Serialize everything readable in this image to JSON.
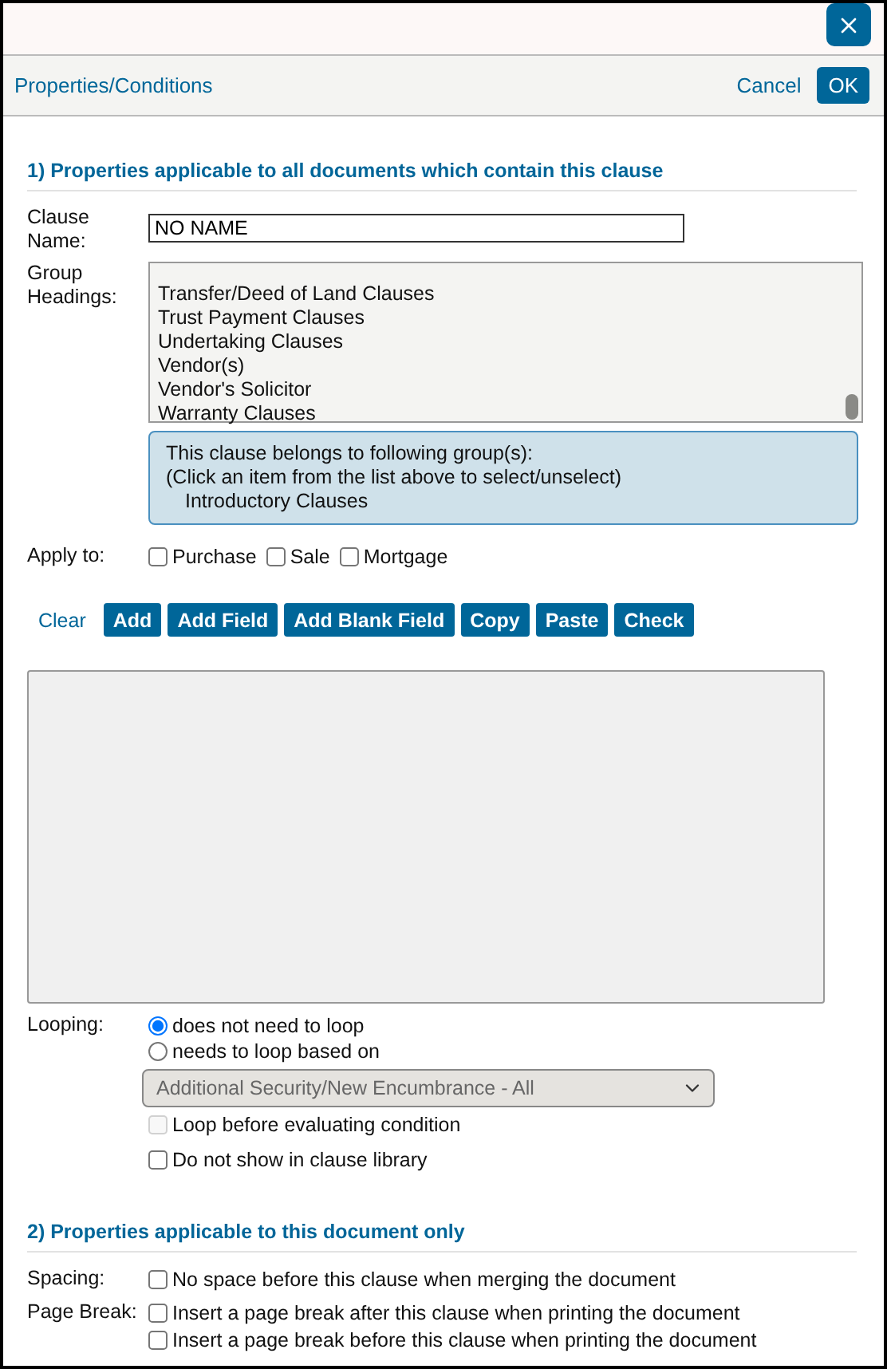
{
  "header": {
    "title": "Properties/Conditions",
    "cancel": "Cancel",
    "ok": "OK"
  },
  "section_1": {
    "heading": "1) Properties applicable to all documents which contain this clause",
    "clause_name": {
      "label": "Clause Name:",
      "value": "NO NAME"
    },
    "group_headings": {
      "label": "Group Headings:",
      "items": [
        {
          "label": "Transfer/Deed of Land Clauses",
          "selected": false
        },
        {
          "label": "Trust Payment Clauses",
          "selected": false
        },
        {
          "label": "Undertaking Clauses",
          "selected": false
        },
        {
          "label": "Vendor(s)",
          "selected": false
        },
        {
          "label": "Vendor's Solicitor",
          "selected": false
        },
        {
          "label": "Warranty Clauses",
          "selected": false
        }
      ],
      "info_lines": [
        "This clause belongs to following group(s):",
        "(Click an item from the list above to select/unselect)"
      ],
      "chosen_groups": [
        "Introductory Clauses"
      ]
    },
    "apply_to": {
      "label": "Apply to:",
      "options": [
        {
          "label": "Purchase",
          "checked": false
        },
        {
          "label": "Sale",
          "checked": false
        },
        {
          "label": "Mortgage",
          "checked": false
        }
      ]
    },
    "toolbar": [
      {
        "label": "Clear",
        "kind": "link"
      },
      {
        "label": "Add",
        "kind": "button"
      },
      {
        "label": "Add Field",
        "kind": "button"
      },
      {
        "label": "Add Blank Field",
        "kind": "button"
      },
      {
        "label": "Copy",
        "kind": "button"
      },
      {
        "label": "Paste",
        "kind": "button"
      },
      {
        "label": "Check",
        "kind": "button"
      }
    ],
    "looping": {
      "label": "Looping:",
      "radios": [
        {
          "label": "does not need to loop",
          "selected": true
        },
        {
          "label": "needs to loop based on",
          "selected": false
        }
      ],
      "loop_over": {
        "value": "Additional Security/New Encumbrance - All",
        "disabled": true
      },
      "checks": [
        {
          "label": "Loop before evaluating condition",
          "checked": false,
          "disabled": true
        },
        {
          "label": "Do not show in clause library",
          "checked": false,
          "disabled": false
        }
      ]
    }
  },
  "section_2": {
    "heading": "2) Properties applicable to this document only",
    "rows": [
      {
        "label": "Spacing:",
        "options": [
          {
            "label": "No space before this clause when merging the document",
            "checked": false
          }
        ]
      },
      {
        "label": "Page Break:",
        "options": [
          {
            "label": "Insert a page break after this clause when printing the document",
            "checked": false
          },
          {
            "label": "Insert a page break before this clause when printing the document",
            "checked": false
          }
        ]
      }
    ]
  }
}
